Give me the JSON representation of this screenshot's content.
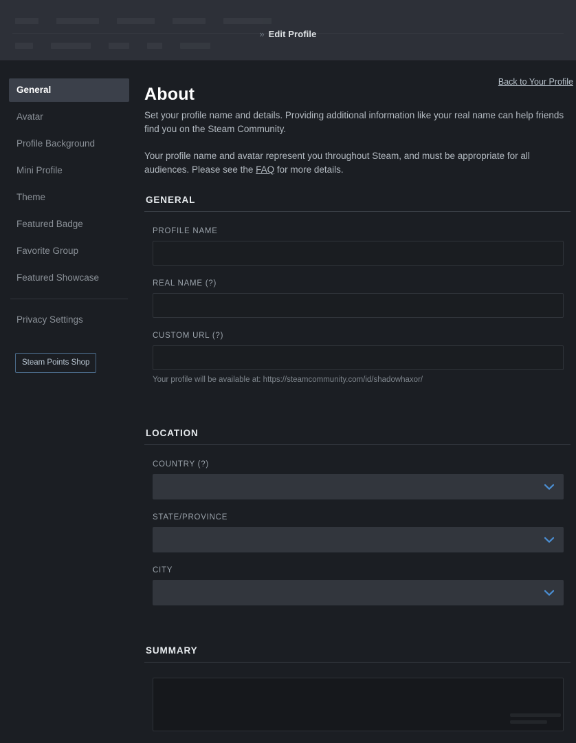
{
  "header": {
    "breadcrumb_separator": "»",
    "breadcrumb_current": "Edit Profile"
  },
  "sidebar": {
    "items": [
      {
        "label": "General",
        "active": true
      },
      {
        "label": "Avatar",
        "active": false
      },
      {
        "label": "Profile Background",
        "active": false
      },
      {
        "label": "Mini Profile",
        "active": false
      },
      {
        "label": "Theme",
        "active": false
      },
      {
        "label": "Featured Badge",
        "active": false
      },
      {
        "label": "Favorite Group",
        "active": false
      },
      {
        "label": "Featured Showcase",
        "active": false
      }
    ],
    "privacy_label": "Privacy Settings",
    "points_shop_label": "Steam Points Shop"
  },
  "main": {
    "back_link": "Back to Your Profile",
    "title": "About",
    "paragraph_1": "Set your profile name and details. Providing additional information like your real name can help friends find you on the Steam Community.",
    "paragraph_2_before": "Your profile name and avatar represent you throughout Steam, and must be appropriate for all audiences. Please see the ",
    "paragraph_2_link": "FAQ",
    "paragraph_2_after": " for more details.",
    "sections": {
      "general": {
        "heading": "GENERAL",
        "profile_name": {
          "label": "PROFILE NAME",
          "value": "",
          "placeholder": ""
        },
        "real_name": {
          "label": "REAL NAME (?)",
          "value": "",
          "placeholder": ""
        },
        "custom_url": {
          "label": "CUSTOM URL (?)",
          "value": "",
          "placeholder": "",
          "hint": "Your profile will be available at: https://steamcommunity.com/id/shadowhaxor/"
        }
      },
      "location": {
        "heading": "LOCATION",
        "country": {
          "label": "COUNTRY (?)",
          "value": "",
          "icon": "chevron-down-icon"
        },
        "state": {
          "label": "STATE/PROVINCE",
          "value": "",
          "icon": "chevron-down-icon"
        },
        "city": {
          "label": "CITY",
          "value": "",
          "icon": "chevron-down-icon"
        }
      },
      "summary": {
        "heading": "SUMMARY",
        "value": "",
        "placeholder": ""
      }
    }
  },
  "colors": {
    "page_bg": "#1b1e23",
    "header_bg": "#2d3038",
    "nav_active_bg": "#3b404a",
    "accent_blue": "#4b8fd4",
    "select_bg": "#32363d",
    "input_bg": "#1a1d21",
    "text_primary": "#ffffff",
    "text_muted": "#8a9097"
  }
}
